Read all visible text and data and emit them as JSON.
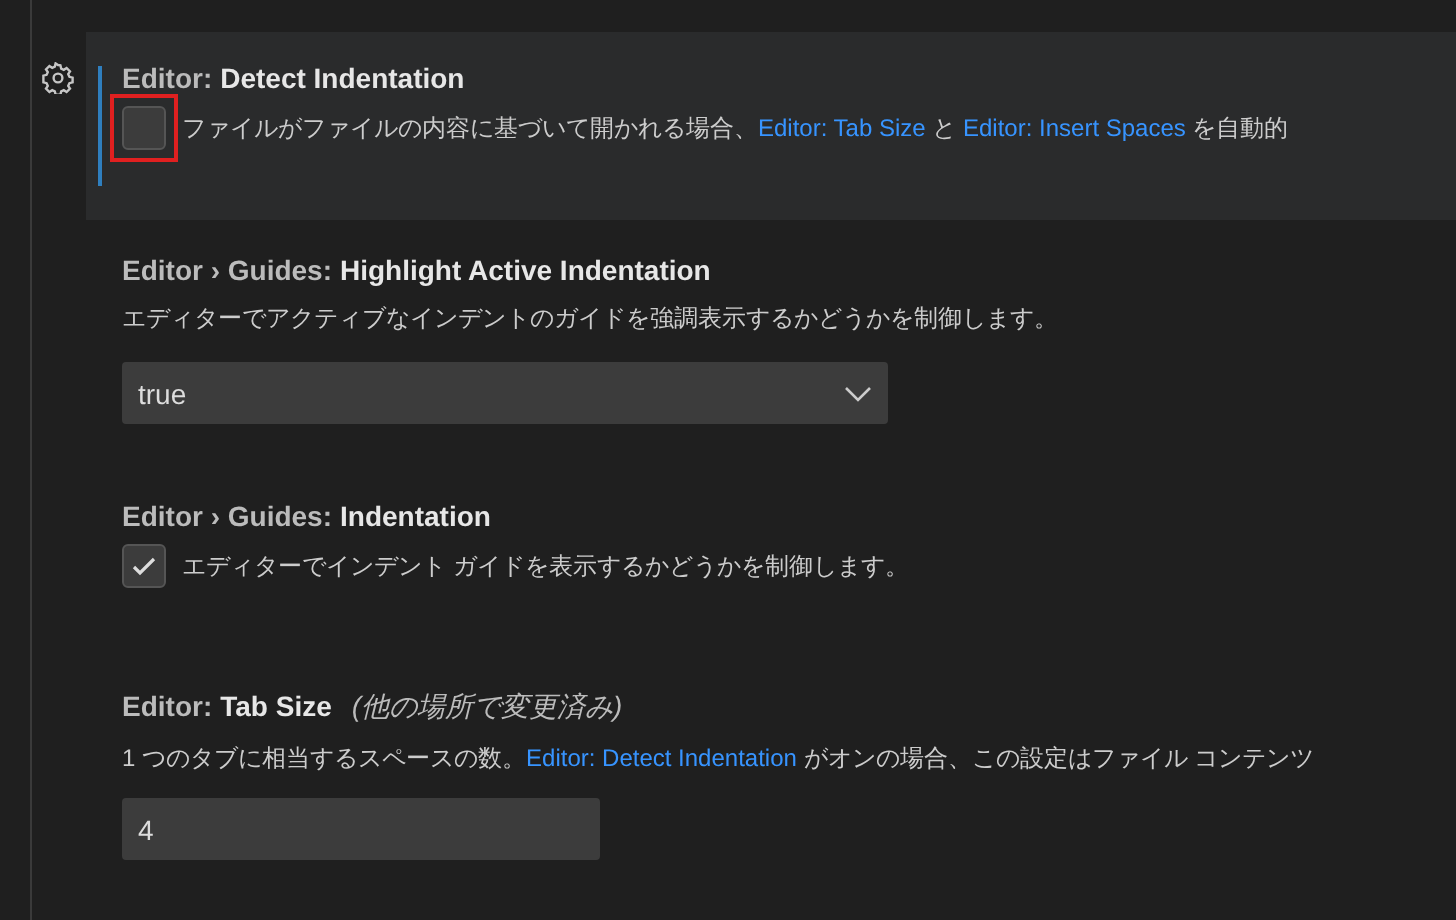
{
  "settings": [
    {
      "category": "Editor:",
      "name": "Detect Indentation",
      "focused": true,
      "kind": "checkbox",
      "checked": false,
      "highlighted": true,
      "description": [
        {
          "kind": "text",
          "text": "ファイルがファイルの内容に基づいて開かれる場合、"
        },
        {
          "kind": "link",
          "text": "Editor: Tab Size"
        },
        {
          "kind": "text",
          "text": " と "
        },
        {
          "kind": "link",
          "text": "Editor: Insert Spaces"
        },
        {
          "kind": "text",
          "text": " を自動的"
        }
      ]
    },
    {
      "category": "Editor › Guides:",
      "name": "Highlight Active Indentation",
      "focused": false,
      "kind": "dropdown",
      "value": "true",
      "description": [
        {
          "kind": "text",
          "text": "エディターでアクティブなインデントのガイドを強調表示するかどうかを制御します。"
        }
      ]
    },
    {
      "category": "Editor › Guides:",
      "name": "Indentation",
      "focused": false,
      "kind": "checkbox",
      "checked": true,
      "highlighted": false,
      "description": [
        {
          "kind": "text",
          "text": "エディターでインデント ガイドを表示するかどうかを制御します。"
        }
      ]
    },
    {
      "category": "Editor:",
      "name": "Tab Size",
      "note": "(他の場所で変更済み)",
      "focused": false,
      "kind": "number",
      "value": "4",
      "description": [
        {
          "kind": "text",
          "text": "1 つのタブに相当するスペースの数。"
        },
        {
          "kind": "link",
          "text": "Editor: Detect Indentation"
        },
        {
          "kind": "text",
          "text": " がオンの場合、この設定はファイル コンテンツ"
        }
      ]
    }
  ]
}
